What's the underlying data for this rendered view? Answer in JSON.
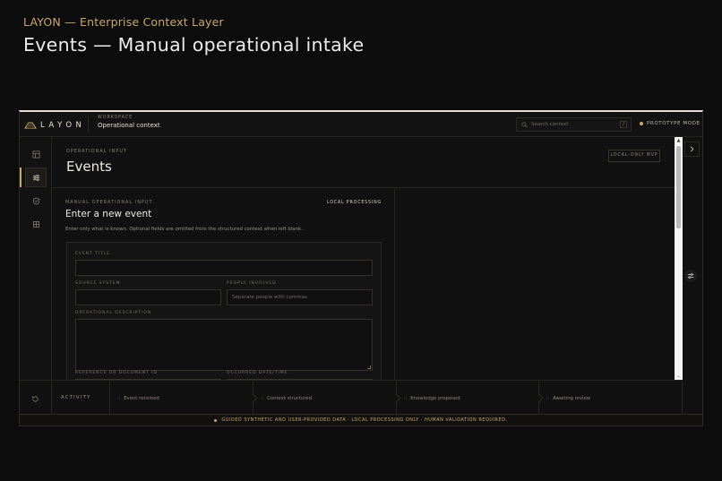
{
  "page": {
    "eyebrow": "LAYON — Enterprise Context Layer",
    "title": "Events — Manual operational intake"
  },
  "topbar": {
    "logo_text": "LAYON",
    "workspace_label": "WORKSPACE",
    "workspace_name": "Operational context",
    "search_placeholder": "Search context",
    "search_shortcut": "/",
    "mode_label": "PROTOTYPE MODE"
  },
  "header": {
    "eyebrow": "OPERATIONAL INPUT",
    "title": "Events",
    "badge": "LOCAL-ONLY MVP"
  },
  "form": {
    "eyebrow": "MANUAL OPERATIONAL INPUT",
    "processing": "LOCAL PROCESSING",
    "title": "Enter a new event",
    "description": "Enter only what is known. Optional fields are omitted from the structured context when left blank.",
    "fields": {
      "event_title": {
        "label": "EVENT TITLE",
        "value": ""
      },
      "source_system": {
        "label": "SOURCE SYSTEM",
        "value": ""
      },
      "people_involved": {
        "label": "PEOPLE INVOLVED",
        "placeholder": "Separate people with commas"
      },
      "operational_description": {
        "label": "OPERATIONAL DESCRIPTION",
        "value": ""
      },
      "reference_id": {
        "label": "REFERENCE OR DOCUMENT ID"
      },
      "occurred_datetime": {
        "label": "OCCURRED DATE/TIME"
      }
    }
  },
  "activity": {
    "label": "ACTIVITY",
    "steps": [
      {
        "label": "Event received"
      },
      {
        "label": "Context structured"
      },
      {
        "label": "Knowledge proposed"
      },
      {
        "label": "Awaiting review"
      }
    ]
  },
  "footer": {
    "notice": "GUIDED SYNTHETIC AND USER-PROVIDED DATA · LOCAL PROCESSING ONLY · HUMAN VALIDATION REQUIRED."
  },
  "colors": {
    "accent": "#c9a86a",
    "background": "#0c0c0c",
    "panel": "#111111",
    "border": "#262420"
  },
  "icons": [
    "layon-logo-icon",
    "search-icon",
    "status-dot-icon",
    "layout-icon",
    "sliders-icon",
    "shield-icon",
    "grid-icon",
    "chevron-right-icon",
    "filter-icon",
    "history-icon",
    "grip-icon"
  ]
}
